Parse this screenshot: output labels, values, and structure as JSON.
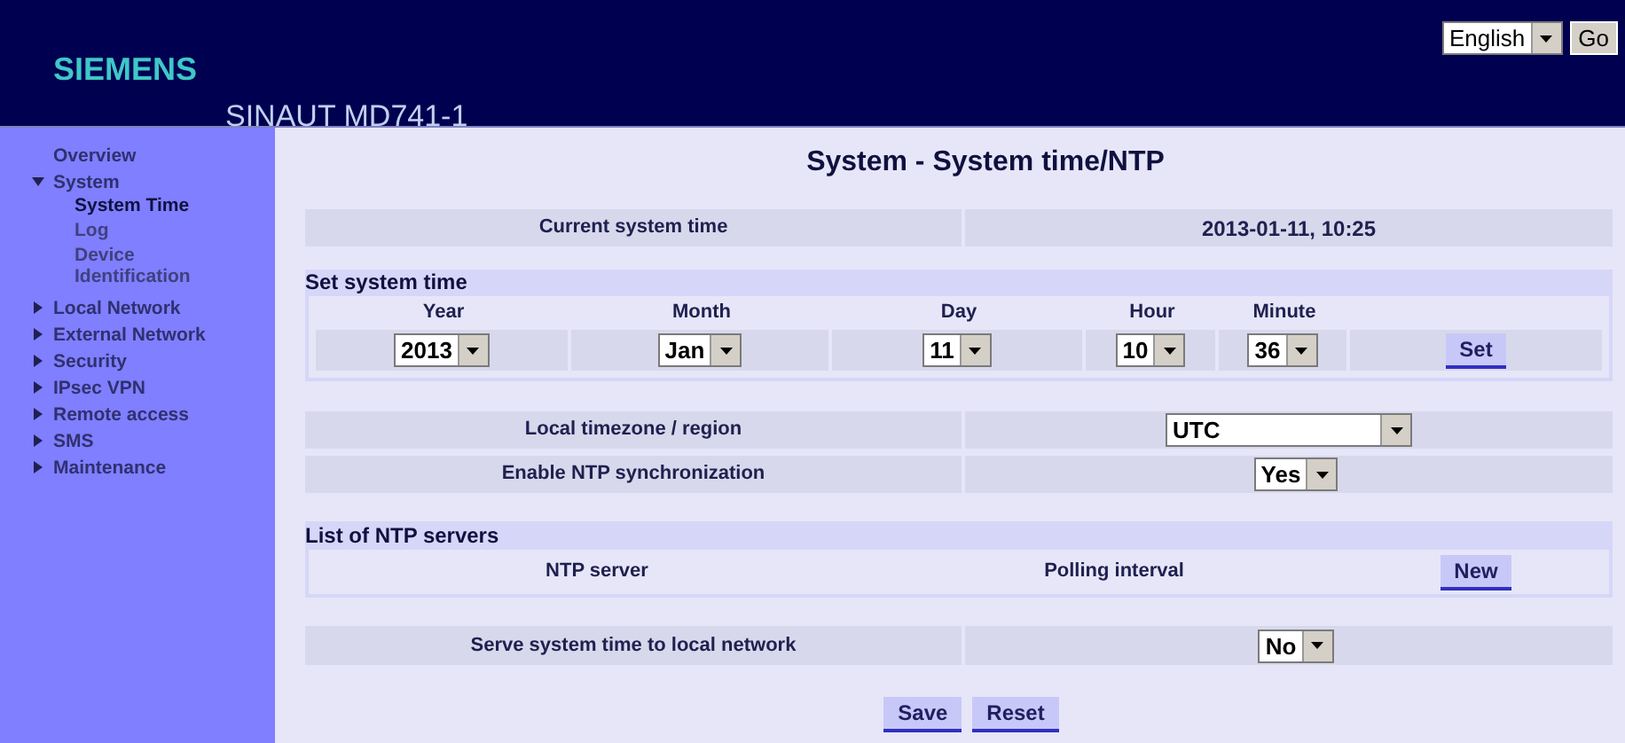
{
  "header": {
    "logo": "SIEMENS",
    "product": "SINAUT MD741-1",
    "language": {
      "value": "English"
    },
    "go_button": "Go"
  },
  "sidebar": {
    "items": [
      {
        "label": "Overview",
        "selected": false
      },
      {
        "label": "System",
        "expanded": true,
        "selected": false,
        "children": [
          {
            "label": "System Time",
            "selected": true
          },
          {
            "label": "Log",
            "selected": false
          },
          {
            "label": "Device Identification",
            "selected": false
          }
        ]
      },
      {
        "label": "Local Network",
        "expanded": false,
        "selected": false
      },
      {
        "label": "External Network",
        "expanded": false,
        "selected": false
      },
      {
        "label": "Security",
        "expanded": false,
        "selected": false
      },
      {
        "label": "IPsec VPN",
        "expanded": false,
        "selected": false
      },
      {
        "label": "Remote access",
        "expanded": false,
        "selected": false
      },
      {
        "label": "SMS",
        "expanded": false,
        "selected": false
      },
      {
        "label": "Maintenance",
        "expanded": false,
        "selected": false
      }
    ]
  },
  "title": "System - System time/NTP",
  "current_time": {
    "label": "Current system time",
    "value": "2013-01-11, 10:25"
  },
  "set_time": {
    "heading": "Set system time",
    "fields": [
      {
        "label": "Year",
        "value": "2013"
      },
      {
        "label": "Month",
        "value": "Jan"
      },
      {
        "label": "Day",
        "value": "11"
      },
      {
        "label": "Hour",
        "value": "10"
      },
      {
        "label": "Minute",
        "value": "36"
      }
    ],
    "button": "Set"
  },
  "settings": [
    {
      "label": "Local timezone / region",
      "value": "UTC",
      "kind": "wide"
    },
    {
      "label": "Enable NTP synchronization",
      "value": "Yes",
      "kind": "narrow"
    }
  ],
  "ntp_servers": {
    "heading": "List of NTP servers",
    "columns": [
      "NTP server",
      "Polling interval"
    ],
    "button": "New"
  },
  "serve_time": {
    "label": "Serve system time to local network",
    "value": "No"
  },
  "buttons": [
    "Save",
    "Reset"
  ]
}
